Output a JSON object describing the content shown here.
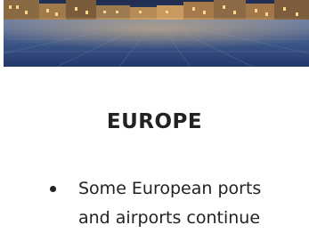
{
  "hero": {
    "image": "grand-place-square-photo"
  },
  "section": {
    "title": "EUROPE"
  },
  "list": {
    "items": [
      {
        "text": "Some European ports"
      },
      {
        "text": "and airports continue"
      }
    ]
  },
  "colors": {
    "text": "#222222",
    "background": "#ffffff",
    "sky": "#2c3f66",
    "cobblestone": "#3a5a8a"
  }
}
